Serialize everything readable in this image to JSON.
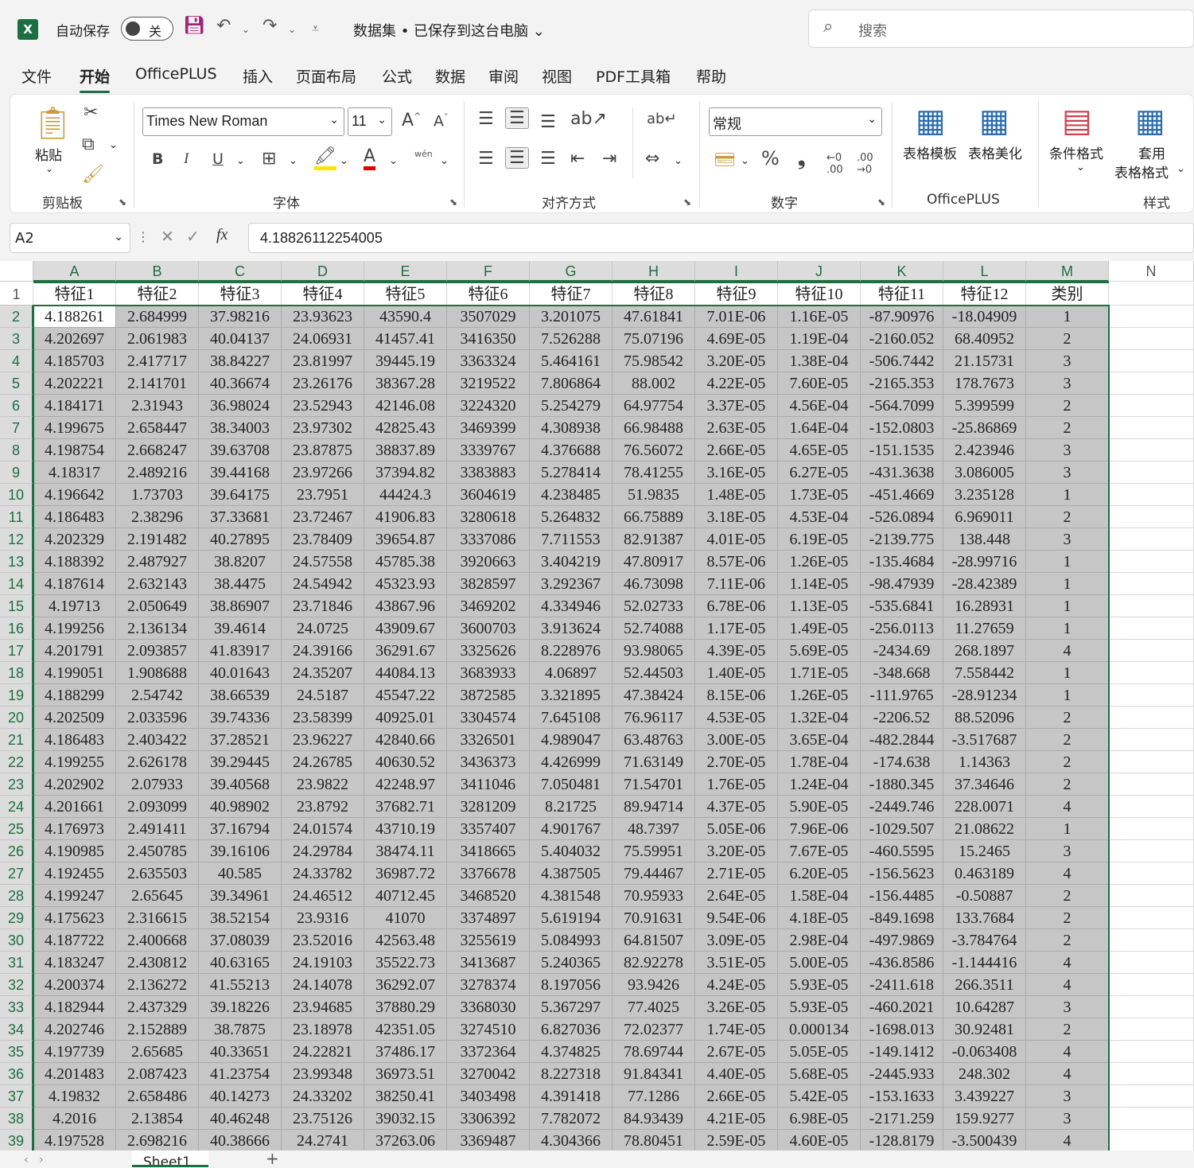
{
  "titlebar": {
    "logo": "X",
    "autosave_label": "自动保存",
    "autosave_state": "关",
    "doc_title": "数据集 • 已保存到这台电脑",
    "search_placeholder": "搜索",
    "icons": [
      "save-icon",
      "undo-icon",
      "redo-icon",
      "customize-icon",
      "search-icon"
    ]
  },
  "tabs": [
    "文件",
    "开始",
    "OfficePLUS",
    "插入",
    "页面布局",
    "公式",
    "数据",
    "审阅",
    "视图",
    "PDF工具箱",
    "帮助"
  ],
  "active_tab": "开始",
  "ribbon": {
    "clipboard": {
      "paste": "粘贴",
      "label": "剪贴板"
    },
    "font": {
      "name": "Times New Roman",
      "size": "11",
      "bold": "B",
      "italic": "I",
      "underline": "U",
      "phonetic": "wén",
      "label": "字体"
    },
    "alignment": {
      "label": "对齐方式"
    },
    "number": {
      "format": "常规",
      "percent": "%",
      "comma": "❟",
      "dec_inc": ".00",
      "dec_dec": ".00",
      "label": "数字"
    },
    "officeplus": {
      "template": "表格模板",
      "beautify": "表格美化",
      "label": "OfficePLUS"
    },
    "styles": {
      "conditional": "条件格式",
      "table_format_1": "套用",
      "table_format_2": "表格格式",
      "label": "样式"
    }
  },
  "formula_bar": {
    "name_box": "A2",
    "fx": "fx",
    "value": "4.18826112254005"
  },
  "columns": [
    "A",
    "B",
    "C",
    "D",
    "E",
    "F",
    "G",
    "H",
    "I",
    "J",
    "K",
    "L",
    "M",
    "N"
  ],
  "headers": [
    "特征1",
    "特征2",
    "特征3",
    "特征4",
    "特征5",
    "特征6",
    "特征7",
    "特征8",
    "特征9",
    "特征10",
    "特征11",
    "特征12",
    "类别"
  ],
  "rows": [
    [
      "4.188261",
      "2.684999",
      "37.98216",
      "23.93623",
      "43590.4",
      "3507029",
      "3.201075",
      "47.61841",
      "7.01E-06",
      "1.16E-05",
      "-87.90976",
      "-18.04909",
      "1"
    ],
    [
      "4.202697",
      "2.061983",
      "40.04137",
      "24.06931",
      "41457.41",
      "3416350",
      "7.526288",
      "75.07196",
      "4.69E-05",
      "1.19E-04",
      "-2160.052",
      "68.40952",
      "2"
    ],
    [
      "4.185703",
      "2.417717",
      "38.84227",
      "23.81997",
      "39445.19",
      "3363324",
      "5.464161",
      "75.98542",
      "3.20E-05",
      "1.38E-04",
      "-506.7442",
      "21.15731",
      "3"
    ],
    [
      "4.202221",
      "2.141701",
      "40.36674",
      "23.26176",
      "38367.28",
      "3219522",
      "7.806864",
      "88.002",
      "4.22E-05",
      "7.60E-05",
      "-2165.353",
      "178.7673",
      "3"
    ],
    [
      "4.184171",
      "2.31943",
      "36.98024",
      "23.52943",
      "42146.08",
      "3224320",
      "5.254279",
      "64.97754",
      "3.37E-05",
      "4.56E-04",
      "-564.7099",
      "5.399599",
      "2"
    ],
    [
      "4.199675",
      "2.658447",
      "38.34003",
      "23.97302",
      "42825.43",
      "3469399",
      "4.308938",
      "66.98488",
      "2.63E-05",
      "1.64E-04",
      "-152.0803",
      "-25.86869",
      "2"
    ],
    [
      "4.198754",
      "2.668247",
      "39.63708",
      "23.87875",
      "38837.89",
      "3339767",
      "4.376688",
      "76.56072",
      "2.66E-05",
      "4.65E-05",
      "-151.1535",
      "2.423946",
      "3"
    ],
    [
      "4.18317",
      "2.489216",
      "39.44168",
      "23.97266",
      "37394.82",
      "3383883",
      "5.278414",
      "78.41255",
      "3.16E-05",
      "6.27E-05",
      "-431.3638",
      "3.086005",
      "3"
    ],
    [
      "4.196642",
      "1.73703",
      "39.64175",
      "23.7951",
      "44424.3",
      "3604619",
      "4.238485",
      "51.9835",
      "1.48E-05",
      "1.73E-05",
      "-451.4669",
      "3.235128",
      "1"
    ],
    [
      "4.186483",
      "2.38296",
      "37.33681",
      "23.72467",
      "41906.83",
      "3280618",
      "5.264832",
      "66.75889",
      "3.18E-05",
      "4.53E-04",
      "-526.0894",
      "6.969011",
      "2"
    ],
    [
      "4.202329",
      "2.191482",
      "40.27895",
      "23.78409",
      "39654.87",
      "3337086",
      "7.711553",
      "82.91387",
      "4.01E-05",
      "6.19E-05",
      "-2139.775",
      "138.448",
      "3"
    ],
    [
      "4.188392",
      "2.487927",
      "38.8207",
      "24.57558",
      "45785.38",
      "3920663",
      "3.404219",
      "47.80917",
      "8.57E-06",
      "1.26E-05",
      "-135.4684",
      "-28.99716",
      "1"
    ],
    [
      "4.187614",
      "2.632143",
      "38.4475",
      "24.54942",
      "45323.93",
      "3828597",
      "3.292367",
      "46.73098",
      "7.11E-06",
      "1.14E-05",
      "-98.47939",
      "-28.42389",
      "1"
    ],
    [
      "4.19713",
      "2.050649",
      "38.86907",
      "23.71846",
      "43867.96",
      "3469202",
      "4.334946",
      "52.02733",
      "6.78E-06",
      "1.13E-05",
      "-535.6841",
      "16.28931",
      "1"
    ],
    [
      "4.199256",
      "2.136134",
      "39.4614",
      "24.0725",
      "43909.67",
      "3600703",
      "3.913624",
      "52.74088",
      "1.17E-05",
      "1.49E-05",
      "-256.0113",
      "11.27659",
      "1"
    ],
    [
      "4.201791",
      "2.093857",
      "41.83917",
      "24.39166",
      "36291.67",
      "3325626",
      "8.228976",
      "93.98065",
      "4.39E-05",
      "5.69E-05",
      "-2434.69",
      "268.1897",
      "4"
    ],
    [
      "4.199051",
      "1.908688",
      "40.01643",
      "24.35207",
      "44084.13",
      "3683933",
      "4.06897",
      "52.44503",
      "1.40E-05",
      "1.71E-05",
      "-348.668",
      "7.558442",
      "1"
    ],
    [
      "4.188299",
      "2.54742",
      "38.66539",
      "24.5187",
      "45547.22",
      "3872585",
      "3.321895",
      "47.38424",
      "8.15E-06",
      "1.26E-05",
      "-111.9765",
      "-28.91234",
      "1"
    ],
    [
      "4.202509",
      "2.033596",
      "39.74336",
      "23.58399",
      "40925.01",
      "3304574",
      "7.645108",
      "76.96117",
      "4.53E-05",
      "1.32E-04",
      "-2206.52",
      "88.52096",
      "2"
    ],
    [
      "4.186483",
      "2.403422",
      "37.28521",
      "23.96227",
      "42840.66",
      "3326501",
      "4.989047",
      "63.48763",
      "3.00E-05",
      "3.65E-04",
      "-482.2844",
      "-3.517687",
      "2"
    ],
    [
      "4.199255",
      "2.626178",
      "39.29445",
      "24.26785",
      "40630.52",
      "3436373",
      "4.426999",
      "71.63149",
      "2.70E-05",
      "1.78E-04",
      "-174.638",
      "1.14363",
      "2"
    ],
    [
      "4.202902",
      "2.07933",
      "39.40568",
      "23.9822",
      "42248.97",
      "3411046",
      "7.050481",
      "71.54701",
      "1.76E-05",
      "1.24E-04",
      "-1880.345",
      "37.34646",
      "2"
    ],
    [
      "4.201661",
      "2.093099",
      "40.98902",
      "23.8792",
      "37682.71",
      "3281209",
      "8.21725",
      "89.94714",
      "4.37E-05",
      "5.90E-05",
      "-2449.746",
      "228.0071",
      "4"
    ],
    [
      "4.176973",
      "2.491411",
      "37.16794",
      "24.01574",
      "43710.19",
      "3357407",
      "4.901767",
      "48.7397",
      "5.05E-06",
      "7.96E-06",
      "-1029.507",
      "21.08622",
      "1"
    ],
    [
      "4.190985",
      "2.450785",
      "39.16106",
      "24.29784",
      "38474.11",
      "3418665",
      "5.404032",
      "75.59951",
      "3.20E-05",
      "7.67E-05",
      "-460.5595",
      "15.2465",
      "3"
    ],
    [
      "4.192455",
      "2.635503",
      "40.585",
      "24.33782",
      "36987.72",
      "3376678",
      "4.387505",
      "79.44467",
      "2.71E-05",
      "6.20E-05",
      "-156.5623",
      "0.463189",
      "4"
    ],
    [
      "4.199247",
      "2.65645",
      "39.34961",
      "24.46512",
      "40712.45",
      "3468520",
      "4.381548",
      "70.95933",
      "2.64E-05",
      "1.58E-04",
      "-156.4485",
      "-0.50887",
      "2"
    ],
    [
      "4.175623",
      "2.316615",
      "38.52154",
      "23.9316",
      "41070",
      "3374897",
      "5.619194",
      "70.91631",
      "9.54E-06",
      "4.18E-05",
      "-849.1698",
      "133.7684",
      "2"
    ],
    [
      "4.187722",
      "2.400668",
      "37.08039",
      "23.52016",
      "42563.48",
      "3255619",
      "5.084993",
      "64.81507",
      "3.09E-05",
      "2.98E-04",
      "-497.9869",
      "-3.784764",
      "2"
    ],
    [
      "4.183247",
      "2.430812",
      "40.63165",
      "24.19103",
      "35522.73",
      "3413687",
      "5.240365",
      "82.92278",
      "3.51E-05",
      "5.00E-05",
      "-436.8586",
      "-1.144416",
      "4"
    ],
    [
      "4.200374",
      "2.136272",
      "41.55213",
      "24.14078",
      "36292.07",
      "3278374",
      "8.197056",
      "93.9426",
      "4.24E-05",
      "5.93E-05",
      "-2411.618",
      "266.3511",
      "4"
    ],
    [
      "4.182944",
      "2.437329",
      "39.18226",
      "23.94685",
      "37880.29",
      "3368030",
      "5.367297",
      "77.4025",
      "3.26E-05",
      "5.93E-05",
      "-460.2021",
      "10.64287",
      "3"
    ],
    [
      "4.202746",
      "2.152889",
      "38.7875",
      "23.18978",
      "42351.05",
      "3274510",
      "6.827036",
      "72.02377",
      "1.74E-05",
      "0.000134",
      "-1698.013",
      "30.92481",
      "2"
    ],
    [
      "4.197739",
      "2.65685",
      "40.33651",
      "24.22821",
      "37486.17",
      "3372364",
      "4.374825",
      "78.69744",
      "2.67E-05",
      "5.05E-05",
      "-149.1412",
      "-0.063408",
      "4"
    ],
    [
      "4.201483",
      "2.087423",
      "41.23754",
      "23.99348",
      "36973.51",
      "3270042",
      "8.227318",
      "91.84341",
      "4.40E-05",
      "5.68E-05",
      "-2445.933",
      "248.302",
      "4"
    ],
    [
      "4.19832",
      "2.658486",
      "40.14273",
      "24.33202",
      "38250.41",
      "3403498",
      "4.391418",
      "77.1286",
      "2.66E-05",
      "5.42E-05",
      "-153.1633",
      "3.439227",
      "3"
    ],
    [
      "4.2016",
      "2.13854",
      "40.46248",
      "23.75126",
      "39032.15",
      "3306392",
      "7.782072",
      "84.93439",
      "4.21E-05",
      "6.98E-05",
      "-2171.259",
      "159.9277",
      "3"
    ],
    [
      "4.197528",
      "2.698216",
      "40.38666",
      "24.2741",
      "37263.06",
      "3369487",
      "4.304366",
      "78.80451",
      "2.59E-05",
      "4.60E-05",
      "-128.8179",
      "-3.500439",
      "4"
    ]
  ],
  "sheet_tab": "Sheet1",
  "accent_color": "#1d6f42"
}
